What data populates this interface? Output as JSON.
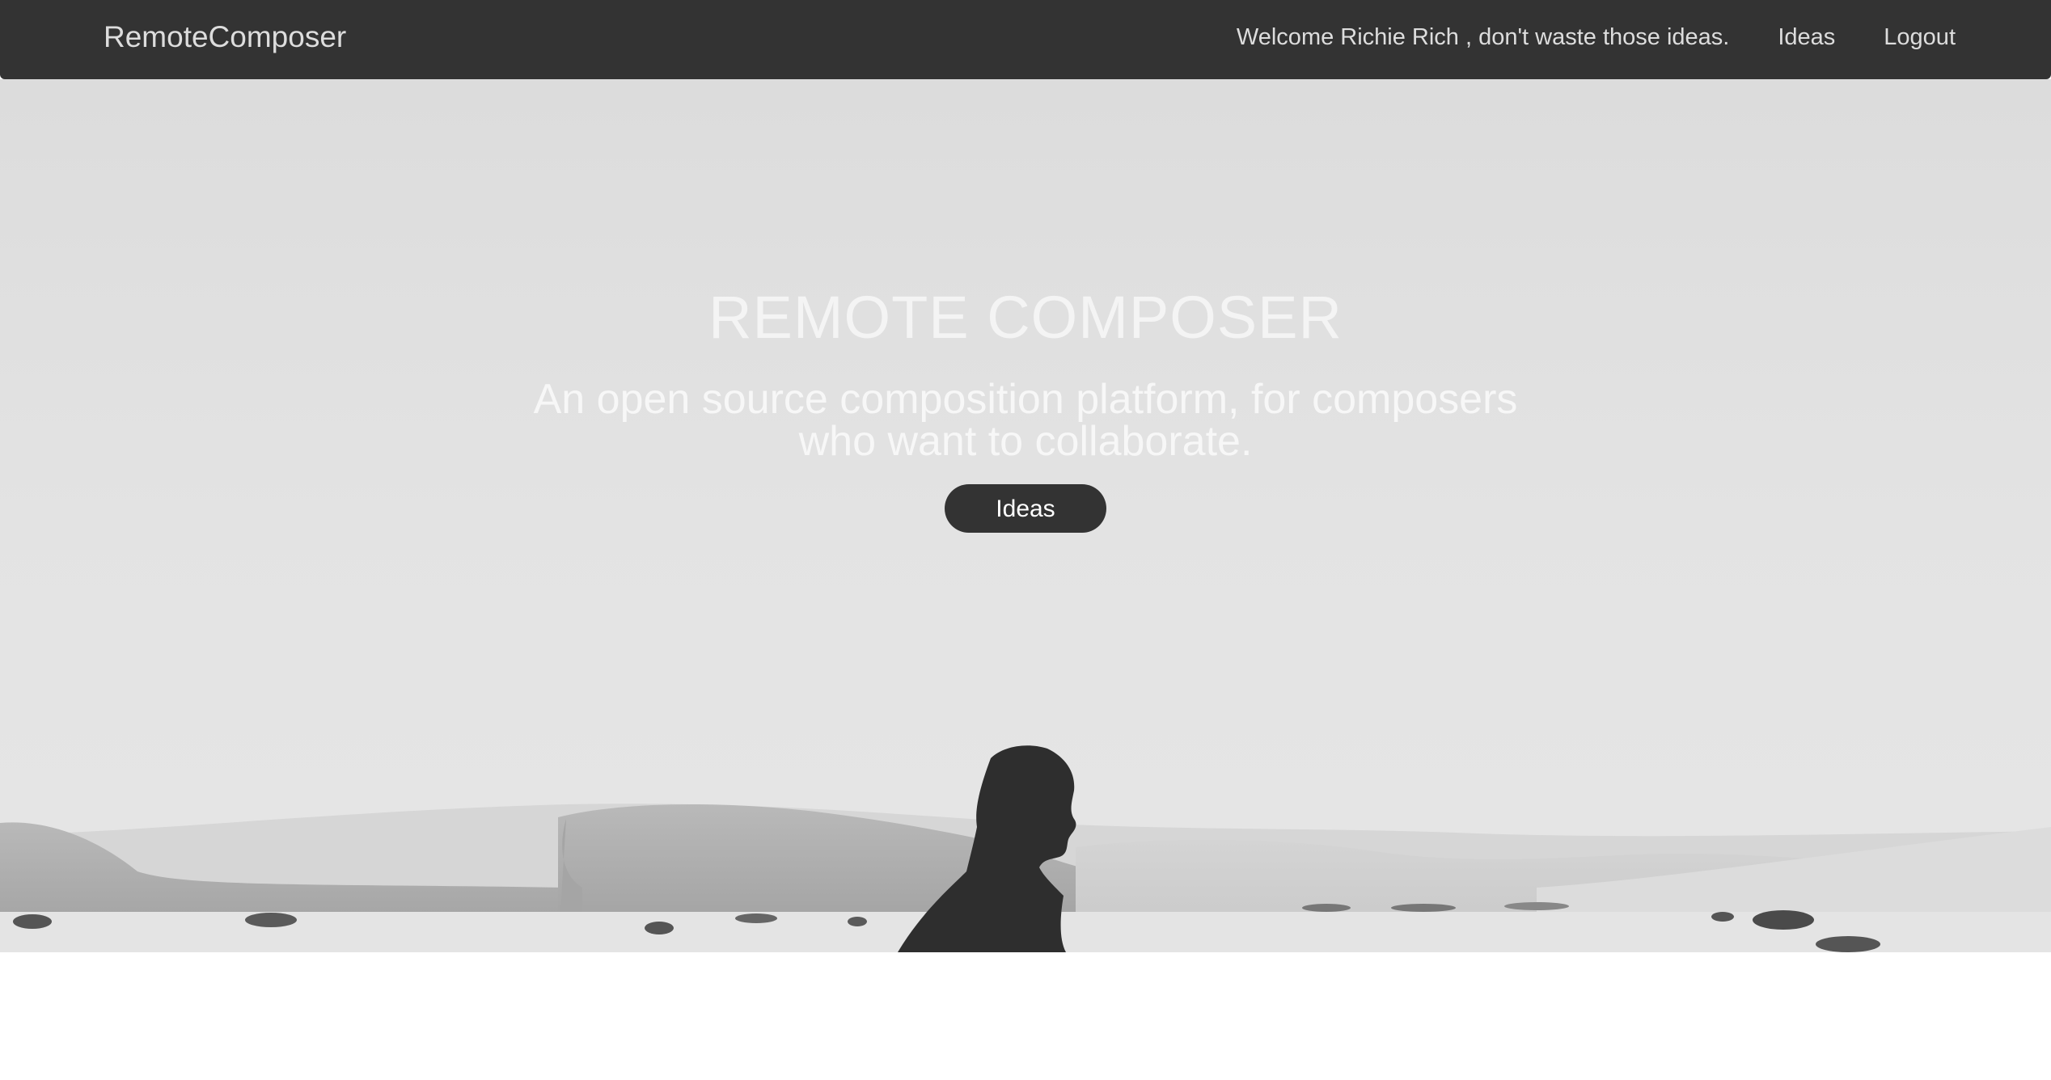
{
  "navbar": {
    "brand": "RemoteComposer",
    "welcome": "Welcome Richie Rich , don't waste those ideas.",
    "links": {
      "ideas": "Ideas",
      "logout": "Logout"
    }
  },
  "hero": {
    "title": "REMOTE COMPOSER",
    "subtitle": "An open source composition platform, for composers who want to collaborate.",
    "button_label": "Ideas",
    "background_image": "desert-dunes-silhouette"
  },
  "colors": {
    "navbar_bg": "#333333",
    "nav_text": "#dddddd",
    "button_bg": "#333333",
    "hero_text": "#f4f4f4"
  }
}
